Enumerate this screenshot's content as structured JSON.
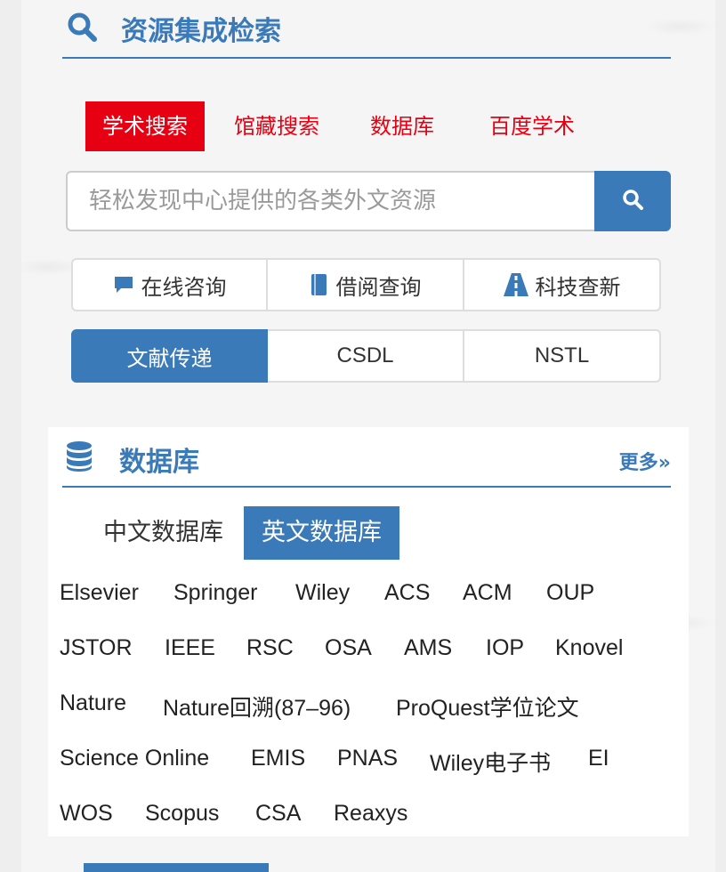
{
  "resource_section": {
    "title": "资源集成检索",
    "tabs": [
      "学术搜索",
      "馆藏搜索",
      "数据库",
      "百度学术"
    ],
    "active_tab": "学术搜索",
    "search_placeholder": "轻松发现中心提供的各类外文资源",
    "service_buttons": [
      "在线咨询",
      "借阅查询",
      "科技查新"
    ],
    "delivery_buttons": [
      "文献传递",
      "CSDL",
      "NSTL"
    ]
  },
  "database_section": {
    "title": "数据库",
    "more_label": "更多»",
    "tabs": [
      "中文数据库",
      "英文数据库"
    ],
    "active_tab": "英文数据库",
    "links": [
      [
        "Elsevier",
        "Springer",
        "Wiley",
        "ACS",
        "ACM",
        "OUP"
      ],
      [
        "JSTOR",
        "IEEE",
        "RSC",
        "OSA",
        "AMS",
        "IOP",
        "Knovel"
      ],
      [
        "Nature",
        "Nature回溯(87–96)",
        "ProQuest学位论文"
      ],
      [
        "Science Online",
        "EMIS",
        "PNAS",
        "Wiley电子书",
        "EI"
      ],
      [
        "WOS",
        "Scopus",
        "CSA",
        "Reaxys"
      ]
    ]
  },
  "colors": {
    "accent": "#3a7ab8",
    "tab_red": "#e60012"
  }
}
